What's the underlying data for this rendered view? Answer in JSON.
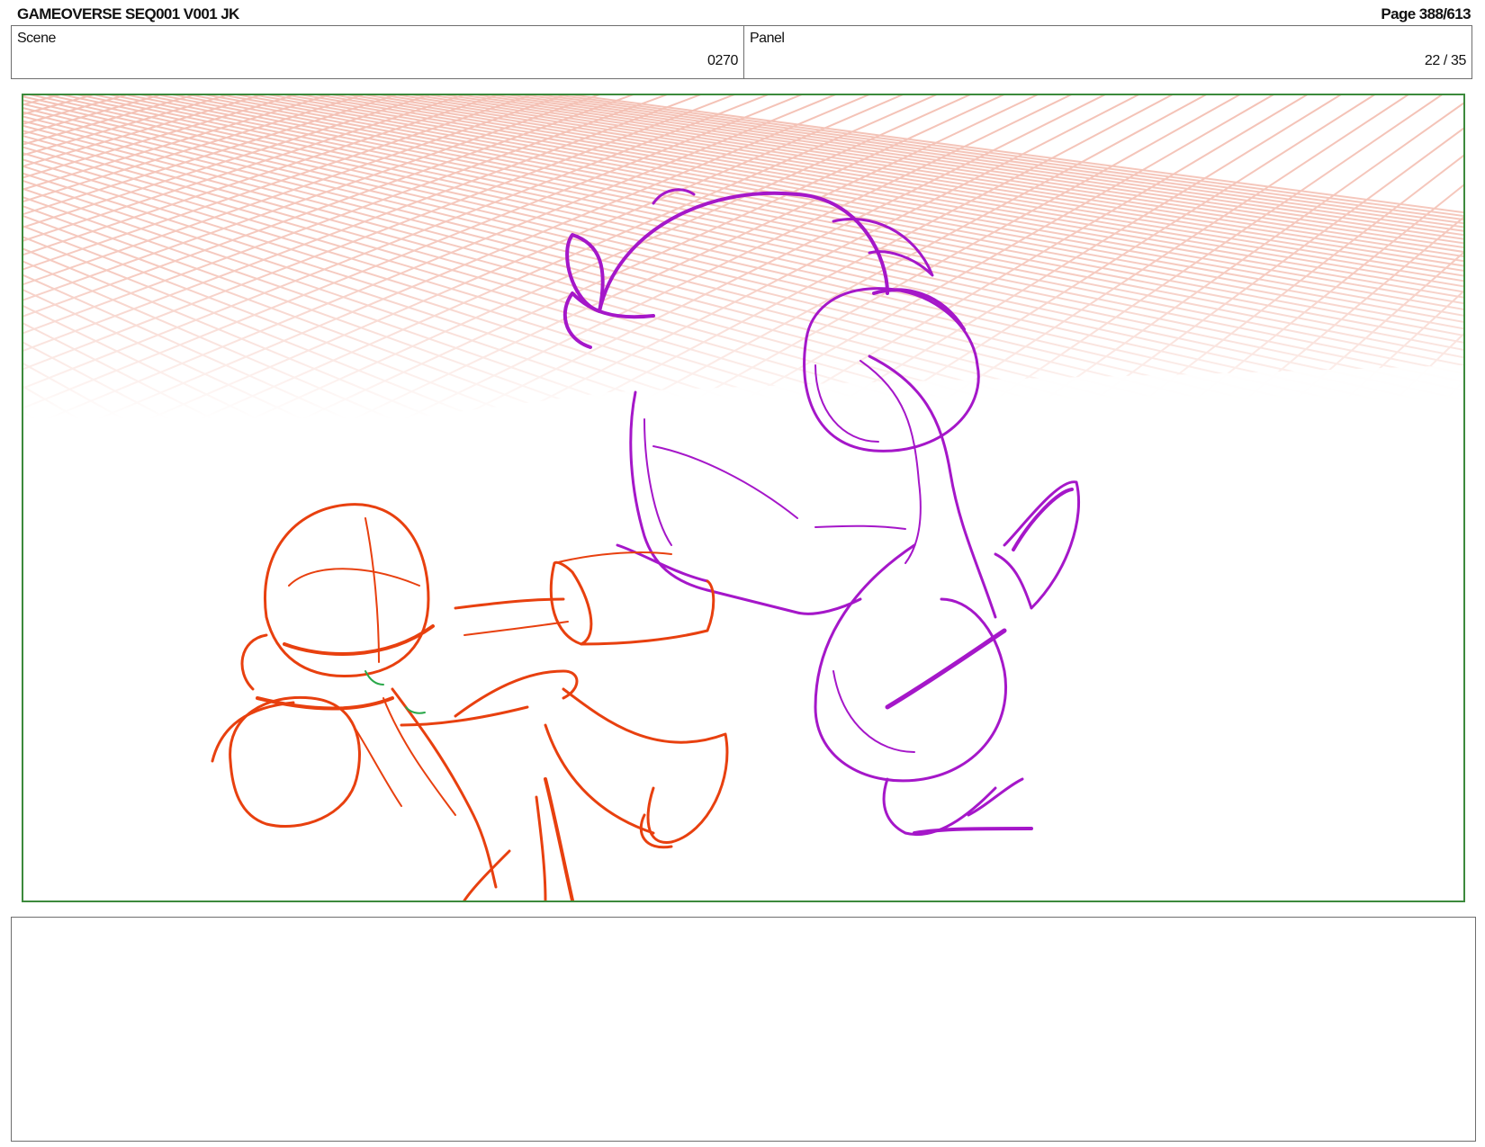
{
  "header": {
    "title": "GAMEOVERSE SEQ001 V001 JK",
    "page": "Page 388/613"
  },
  "info": {
    "scene_label": "Scene",
    "scene_value": "0270",
    "panel_label": "Panel",
    "panel_value": "22 / 35"
  },
  "colors": {
    "frame_border": "#3c8a3c",
    "grid_lines": "#f4c2b6",
    "sketch_red": "#e8400f",
    "sketch_purple": "#a517c9",
    "sketch_green": "#2aa84a"
  },
  "notes": {
    "text": ""
  }
}
